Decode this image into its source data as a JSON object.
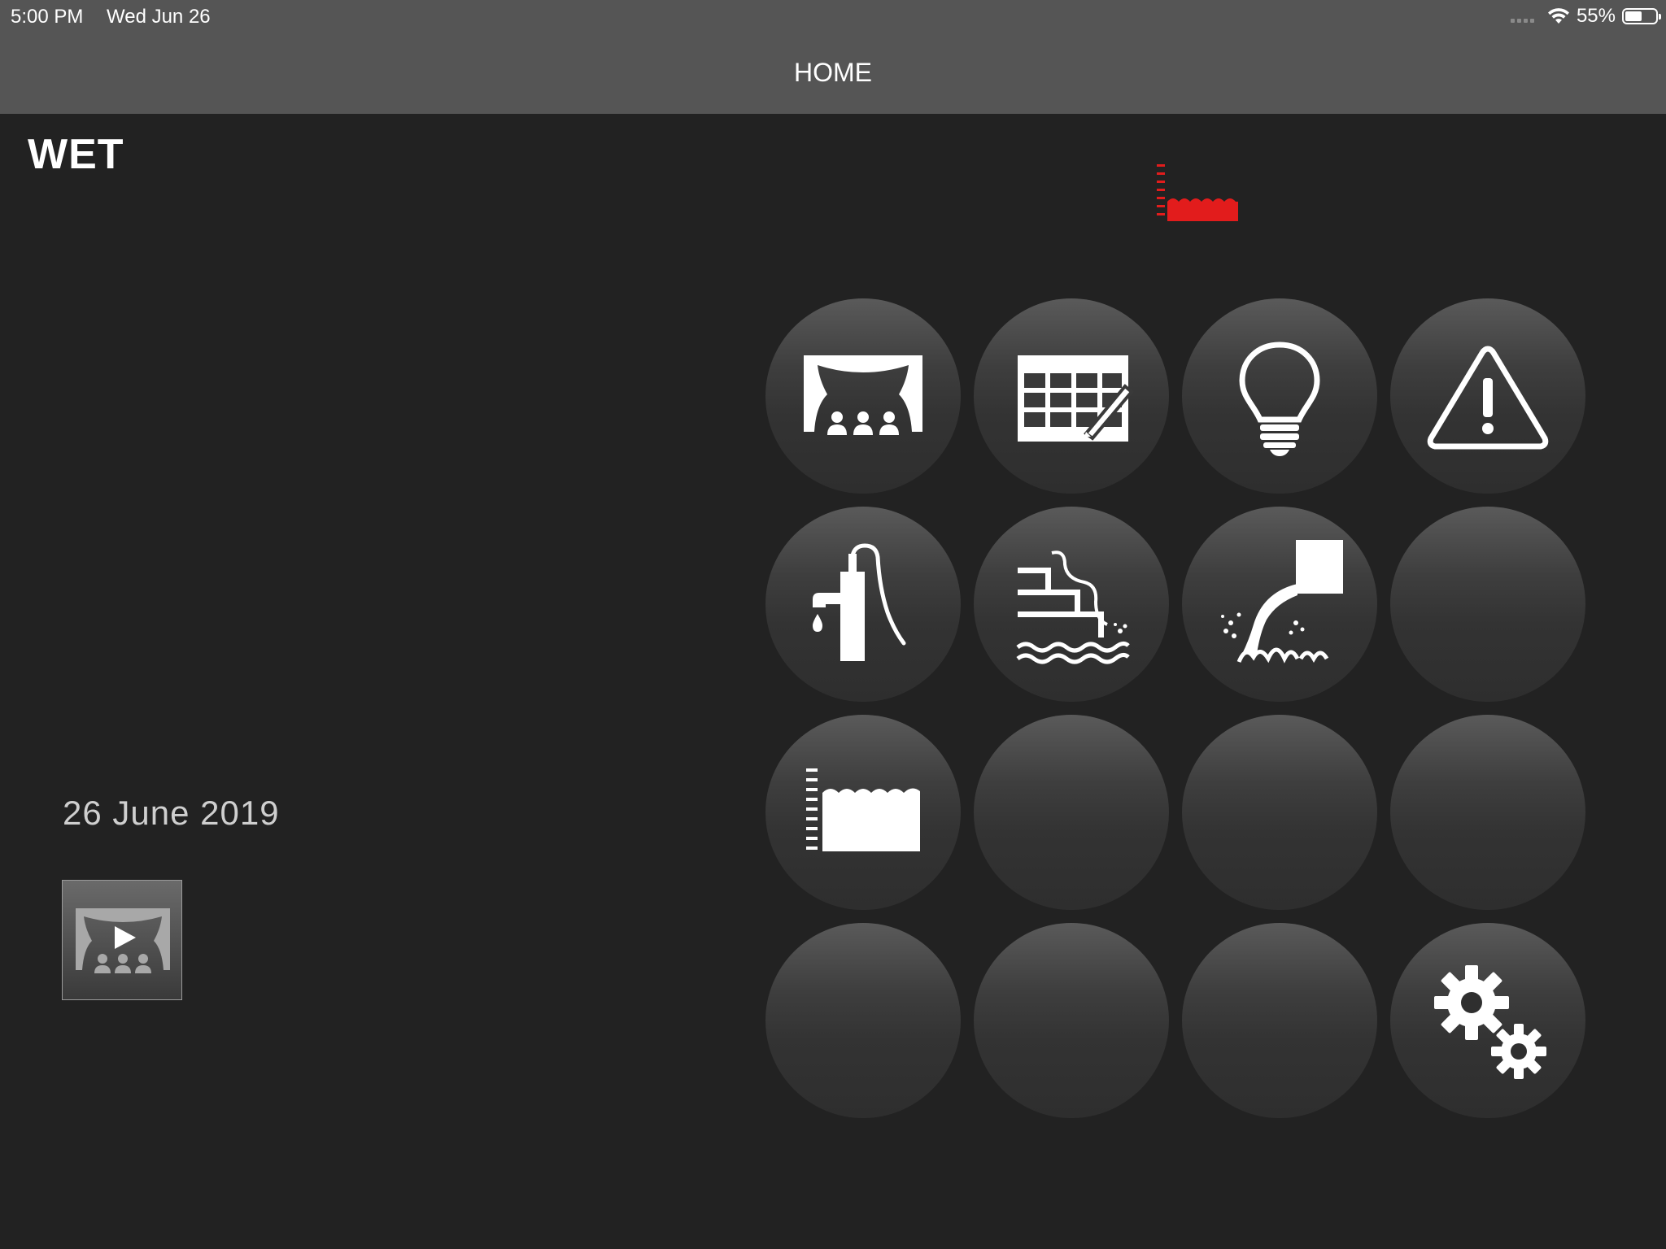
{
  "status_bar": {
    "time": "5:00 PM",
    "date": "Wed Jun 26",
    "battery": "55%",
    "battery_level": 0.55
  },
  "nav": {
    "title": "HOME"
  },
  "page": {
    "title": "WET",
    "date": "26 June 2019"
  },
  "grid": {
    "buttons": [
      {
        "icon": "theater-icon"
      },
      {
        "icon": "schedule-edit-icon"
      },
      {
        "icon": "light-bulb-icon"
      },
      {
        "icon": "warning-icon"
      },
      {
        "icon": "water-pump-icon"
      },
      {
        "icon": "pool-stairs-icon"
      },
      {
        "icon": "fountain-icon"
      },
      {
        "icon": ""
      },
      {
        "icon": "water-level-icon"
      },
      {
        "icon": ""
      },
      {
        "icon": ""
      },
      {
        "icon": ""
      },
      {
        "icon": ""
      },
      {
        "icon": ""
      },
      {
        "icon": ""
      },
      {
        "icon": "settings-gears-icon"
      }
    ]
  },
  "colors": {
    "background": "#222222",
    "nav_bar": "#555555",
    "alert_red": "#e21c1c",
    "icon": "#ffffff"
  }
}
